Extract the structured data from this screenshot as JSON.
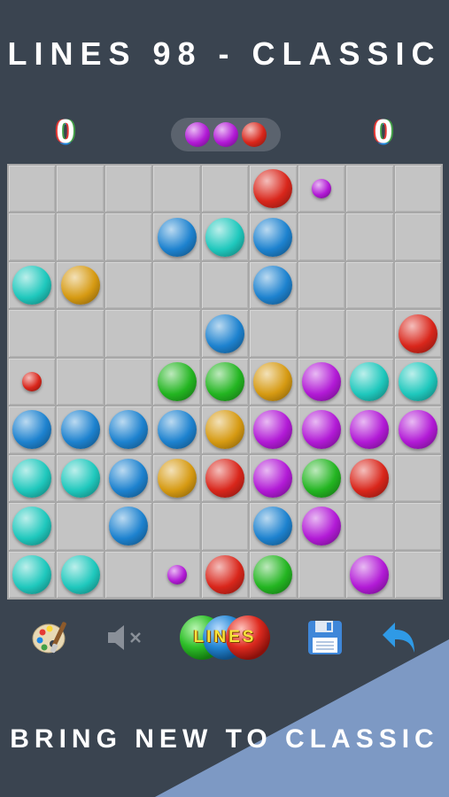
{
  "title": "LINES 98 - CLASSIC",
  "tagline": "BRING NEW TO CLASSIC",
  "score_left": "0",
  "score_right": "0",
  "colors": {
    "purple": "#b21ad6",
    "red": "#d9261b",
    "blue": "#1d82cf",
    "cyan": "#1fc8bd",
    "green": "#23b521",
    "yellow": "#d69a12",
    "background": "#3a4450",
    "accent_band": "#7d99c4"
  },
  "next_balls": [
    "purple",
    "purple",
    "red"
  ],
  "board": [
    [
      "",
      "",
      "",
      "",
      "",
      "red",
      "purple-s",
      "",
      ""
    ],
    [
      "",
      "",
      "",
      "blue",
      "cyan",
      "blue",
      "",
      "",
      ""
    ],
    [
      "cyan",
      "yellow",
      "",
      "",
      "",
      "blue",
      "",
      "",
      ""
    ],
    [
      "",
      "",
      "",
      "",
      "blue",
      "",
      "",
      "",
      "red"
    ],
    [
      "red-s",
      "",
      "",
      "green",
      "green",
      "yellow",
      "purple",
      "cyan",
      "cyan"
    ],
    [
      "blue",
      "blue",
      "blue",
      "blue",
      "yellow",
      "purple",
      "purple",
      "purple",
      "purple"
    ],
    [
      "cyan",
      "cyan",
      "blue",
      "yellow",
      "red",
      "purple",
      "green",
      "red",
      ""
    ],
    [
      "cyan",
      "",
      "blue",
      "",
      "",
      "blue",
      "purple",
      "",
      ""
    ],
    [
      "cyan",
      "cyan",
      "",
      "purple-s",
      "red",
      "green",
      "",
      "purple",
      ""
    ]
  ],
  "toolbar": {
    "theme": "palette-icon",
    "sound": "speaker-muted-icon",
    "logo_text": "LINES",
    "save": "floppy-disk-icon",
    "undo": "undo-arrow-icon"
  }
}
